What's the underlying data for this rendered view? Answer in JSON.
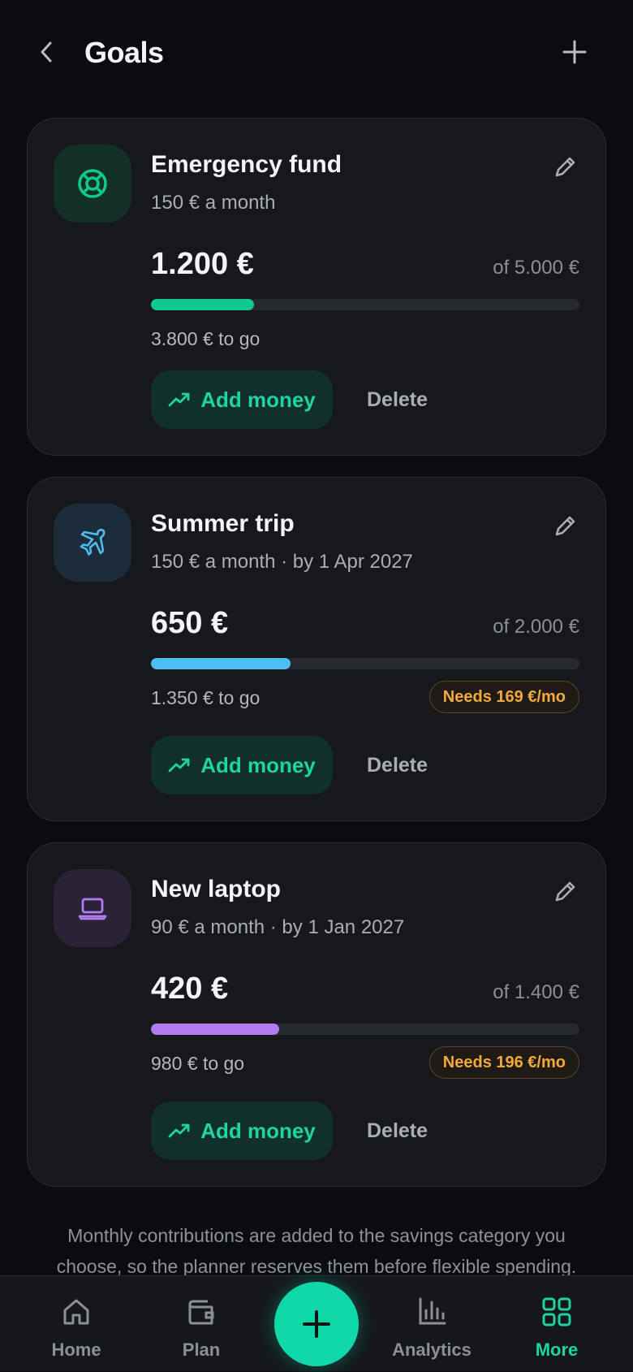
{
  "header": {
    "title": "Goals"
  },
  "goals": [
    {
      "name": "Emergency fund",
      "subtitle": "150 € a month",
      "amount": "1.200 €",
      "target": "of 5.000 €",
      "to_go": "3.800 € to go",
      "progress": 0.24,
      "color": "#10c98f",
      "icon": "lifebuoy-icon",
      "icon_bg": "#123028",
      "icon_color": "#10c98f",
      "needs": null,
      "add_label": "Add money",
      "delete_label": "Delete"
    },
    {
      "name": "Summer trip",
      "subtitle": "150 € a month · by 1 Apr 2027",
      "amount": "650 €",
      "target": "of 2.000 €",
      "to_go": "1.350 € to go",
      "progress": 0.325,
      "color": "#4ebdf2",
      "icon": "airplane-icon",
      "icon_bg": "#1c2c3a",
      "icon_color": "#4ebdf2",
      "needs": "Needs 169 €/mo",
      "add_label": "Add money",
      "delete_label": "Delete"
    },
    {
      "name": "New laptop",
      "subtitle": "90 € a month · by 1 Jan 2027",
      "amount": "420 €",
      "target": "of 1.400 €",
      "to_go": "980 € to go",
      "progress": 0.3,
      "color": "#b27cf0",
      "icon": "laptop-icon",
      "icon_bg": "#2a2336",
      "icon_color": "#b27cf0",
      "needs": "Needs 196 €/mo",
      "add_label": "Add money",
      "delete_label": "Delete"
    }
  ],
  "note": "Monthly contributions are added to the savings category you choose, so the planner reserves them before flexible spending.",
  "tabbar": {
    "home": "Home",
    "plan": "Plan",
    "analytics": "Analytics",
    "more": "More",
    "active": "more"
  },
  "colors": {
    "accent": "#10d8a8",
    "warning": "#f4a93a"
  }
}
